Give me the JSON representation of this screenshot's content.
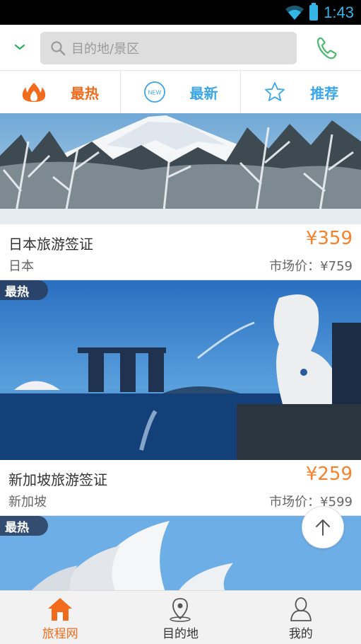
{
  "status_bar": {
    "time": "1:43"
  },
  "header": {
    "search_placeholder": "目的地/景区"
  },
  "tabs": [
    {
      "label": "最热",
      "icon": "flame-icon",
      "active": true
    },
    {
      "label": "最新",
      "icon": "new-badge-icon",
      "badge_text": "NEW"
    },
    {
      "label": "推荐",
      "icon": "star-icon"
    }
  ],
  "cards": [
    {
      "title": "日本旅游签证",
      "price": "¥359",
      "destination": "日本",
      "market_price": "市场价：¥759",
      "image": "mount-fuji-snow-photo"
    },
    {
      "badge": "最热",
      "title": "新加坡旅游签证",
      "price": "¥259",
      "destination": "新加坡",
      "market_price": "市场价：¥599",
      "image": "singapore-merlion-marina-bay-photo"
    },
    {
      "badge": "最热",
      "image": "sydney-opera-house-photo"
    }
  ],
  "bottom_nav": [
    {
      "label": "旅程网",
      "icon": "home-icon",
      "active": true
    },
    {
      "label": "目的地",
      "icon": "map-pin-icon"
    },
    {
      "label": "我的",
      "icon": "user-icon"
    }
  ],
  "colors": {
    "accent_orange": "#f26b1d",
    "price_orange": "#f5822a",
    "accent_blue": "#3aa6e8",
    "phone_green": "#4cb870"
  }
}
